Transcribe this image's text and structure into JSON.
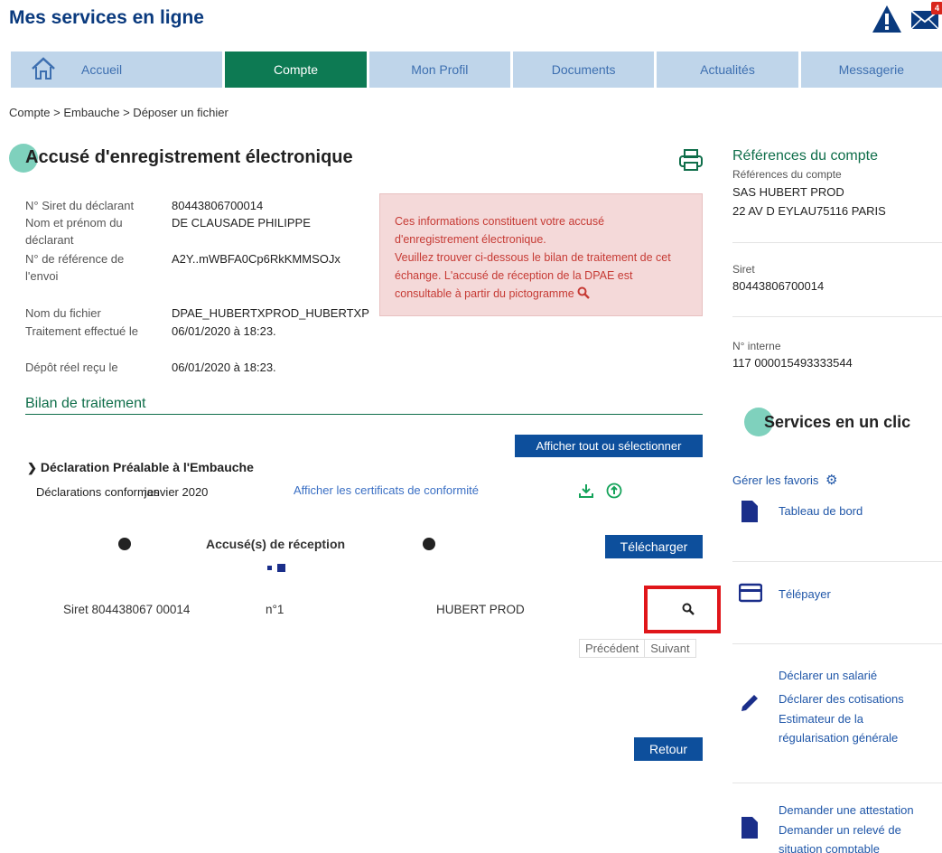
{
  "header": {
    "title": "Mes services en ligne",
    "mail_count": "4"
  },
  "nav": {
    "tabs": [
      "Accueil",
      "Compte",
      "Mon Profil",
      "Documents",
      "Actualités",
      "Messagerie"
    ],
    "active": "Compte"
  },
  "breadcrumb": "Compte > Embauche > Déposer un fichier",
  "main": {
    "heading": "Accusé d'enregistrement électronique",
    "info": {
      "siret_label": "N° Siret du déclarant",
      "siret_value": "80443806700014",
      "name_label": "Nom et prénom du déclarant",
      "name_value": "DE CLAUSADE PHILIPPE",
      "ref_label": "N° de référence de l'envoi",
      "ref_value": "A2Y..mWBFA0Cp6RkKMMSOJx",
      "file_label": "Nom du fichier",
      "file_value": "DPAE_HUBERTXPROD_HUBERTXP",
      "done_label": "Traitement effectué le",
      "done_value": "06/01/2020 à 18:23.",
      "deposit_label": "Dépôt réel reçu le",
      "deposit_value": "06/01/2020 à 18:23."
    },
    "notice": {
      "line1": "Ces informations constituent votre accusé d'enregistrement électronique.",
      "line2": "Veuillez trouver ci-dessous le bilan de traitement de cet échange. L'accusé de réception de la DPAE est consultable à partir du pictogramme"
    },
    "bilan_title": "Bilan de traitement",
    "show_all_button": "Afficher tout ou sélectionner",
    "section_title": "Déclaration Préalable à l'Embauche",
    "conformes_label": "Déclarations conformes",
    "conformes_period": "janvier 2020",
    "certificats_link": "Afficher les certificats de conformité",
    "accuses_header": "Accusé(s) de réception",
    "telecharger_button": "Télécharger",
    "row": {
      "siret": "Siret 804438067 00014",
      "numero": "n°1",
      "company": "HUBERT PROD"
    },
    "pager": {
      "prev": "Précédent",
      "next": "Suivant"
    },
    "retour_button": "Retour"
  },
  "sidebar": {
    "refs_title": "Références du compte",
    "refs_sub": "Références du compte",
    "company": "SAS HUBERT PROD",
    "address": "22 AV D EYLAU75116 PARIS",
    "siret_label": "Siret",
    "siret_value": "80443806700014",
    "interne_label": "N° interne",
    "interne_value": "117 000015493333544",
    "services_title": "Services en un clic",
    "favoris": "Gérer les favoris",
    "tableau": "Tableau de bord",
    "telepayer": "Télépayer",
    "declarer_salarie": "Déclarer un salarié",
    "declarer_cotisations": "Déclarer des cotisations",
    "estimateur": "Estimateur de la régularisation générale",
    "attestation": "Demander une attestation",
    "releve": "Demander un relevé de situation comptable"
  },
  "colors": {
    "brand_blue": "#0a3a7e",
    "active_tab": "#0d7a53",
    "button_blue": "#0d4f9c",
    "highlight_red": "#e0161a"
  }
}
